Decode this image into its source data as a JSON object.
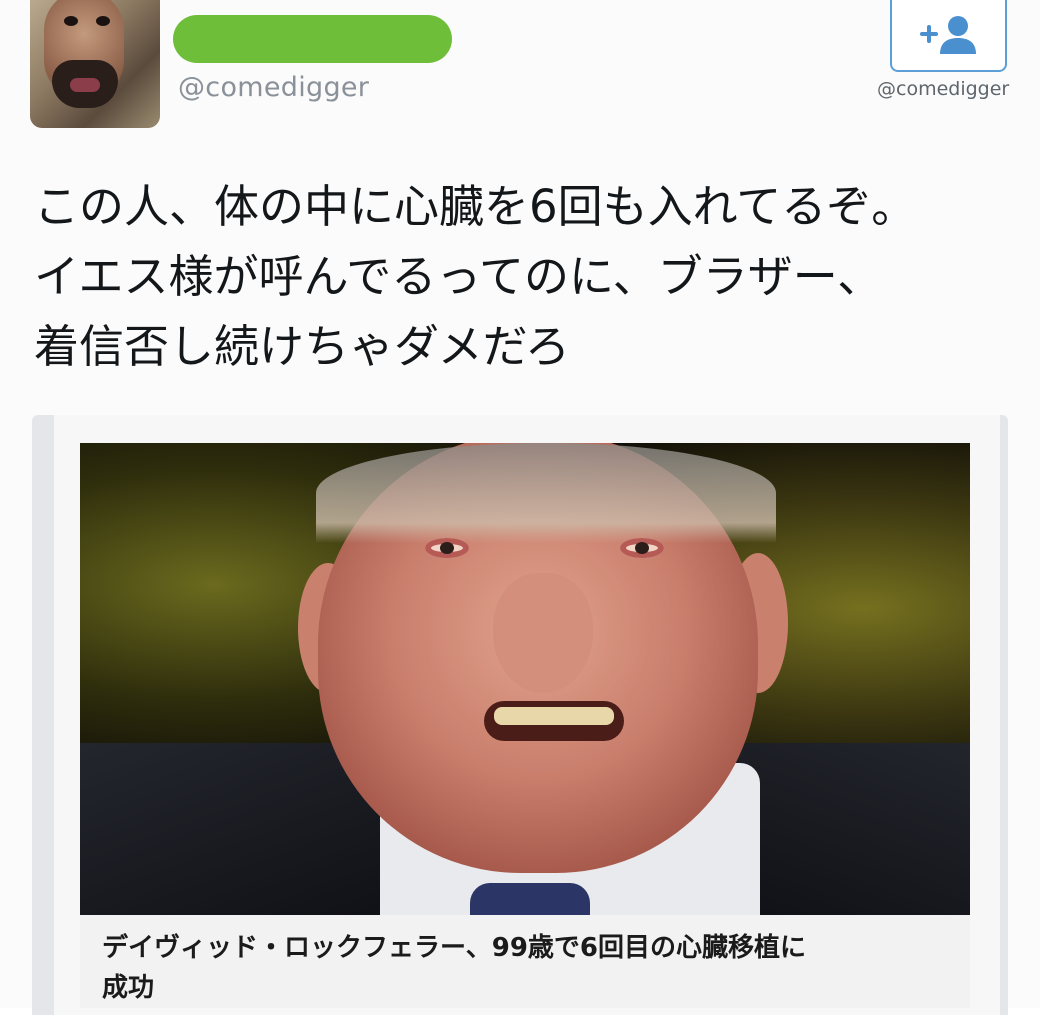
{
  "tweet": {
    "handle": "@comedigger",
    "text_lines": [
      "この人、体の中に心臓を6回も入れてるぞ。",
      "イエス様が呼んでるってのに、ブラザー、",
      "着信否し続けちゃダメだろ"
    ]
  },
  "follow": {
    "icon": "add-user-icon",
    "handle": "@comedigger"
  },
  "card": {
    "caption_lines": [
      "デイヴィッド・ロックフェラー、99歳で6回目の心臓移植に",
      "成功"
    ]
  },
  "colors": {
    "name_bar": "#6fbe3a",
    "follow_border": "#5b9fd6",
    "handle_gray": "#8a9199"
  }
}
